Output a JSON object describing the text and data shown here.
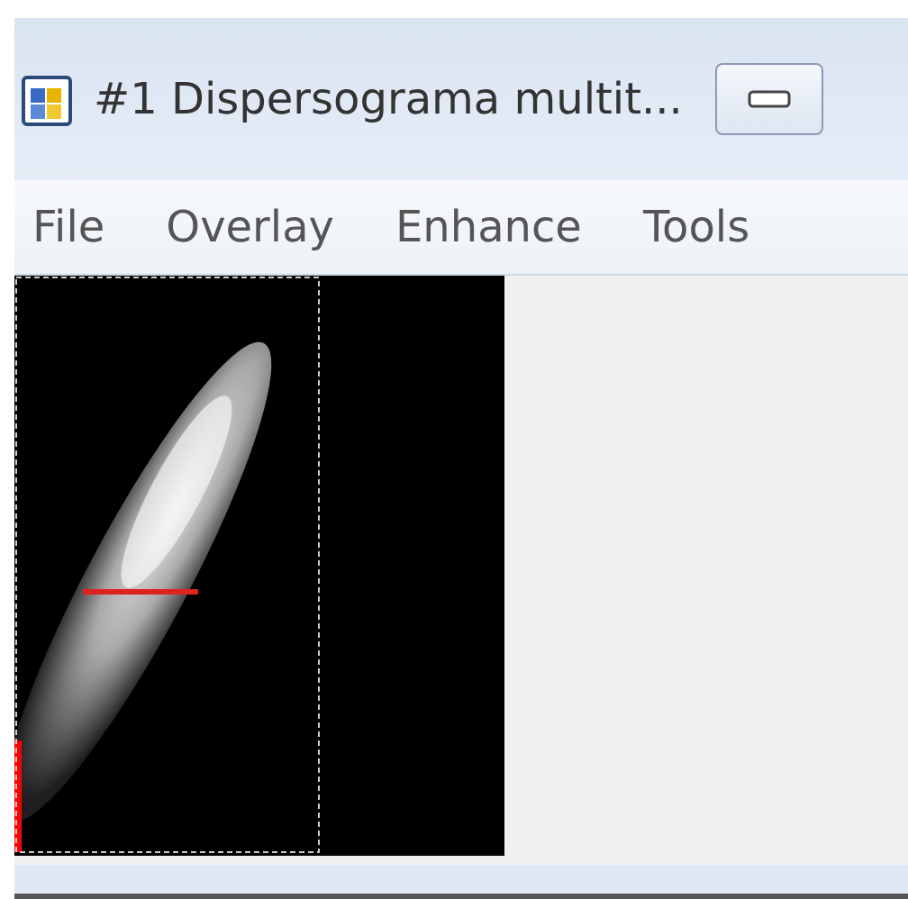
{
  "window": {
    "title": "#1 Dispersograma multit..."
  },
  "menu": [
    {
      "label": "File"
    },
    {
      "label": "Overlay"
    },
    {
      "label": "Enhance"
    },
    {
      "label": "Tools"
    }
  ]
}
